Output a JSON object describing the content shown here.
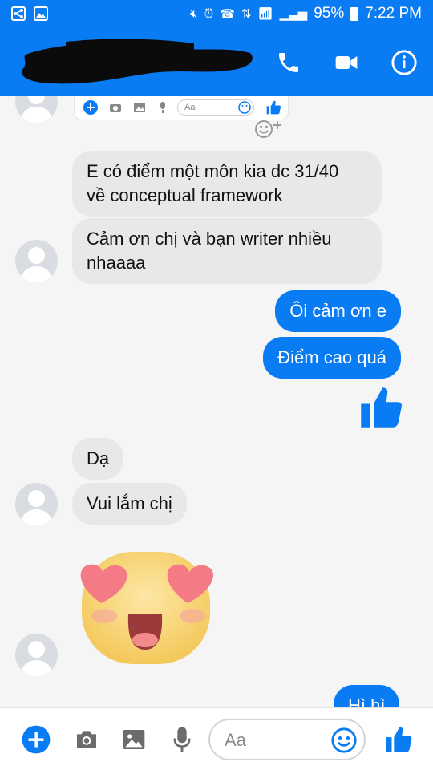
{
  "status_bar": {
    "battery": "95%",
    "time": "7:22 PM"
  },
  "header": {
    "contact_name_redacted": true
  },
  "messages": [
    {
      "id": "m1",
      "side": "incoming",
      "text_lines": [
        "E có điểm một môn kia dc 31/40",
        "về conceptual framework"
      ]
    },
    {
      "id": "m2",
      "side": "incoming",
      "text_lines": [
        "Cảm ơn chị và bạn writer nhiều",
        "nhaaaa"
      ]
    },
    {
      "id": "m3",
      "side": "outgoing",
      "text": "Ôi cảm ơn e"
    },
    {
      "id": "m4",
      "side": "outgoing",
      "text": "Điểm cao quá"
    },
    {
      "id": "m5",
      "side": "outgoing",
      "type": "like-sticker"
    },
    {
      "id": "m6",
      "side": "incoming",
      "text": "Dạ"
    },
    {
      "id": "m7",
      "side": "incoming",
      "text": "Vui lắm chị"
    },
    {
      "id": "m8",
      "side": "incoming",
      "type": "heart-eyes-sticker"
    },
    {
      "id": "m9",
      "side": "outgoing",
      "text": "Hì hì"
    }
  ],
  "mini_composer": {
    "placeholder": "Aa"
  },
  "composer": {
    "placeholder": "Aa"
  },
  "colors": {
    "brand": "#0a7cf3",
    "incoming_bubble": "#e8e8e8",
    "background": "#f5f5f5"
  }
}
